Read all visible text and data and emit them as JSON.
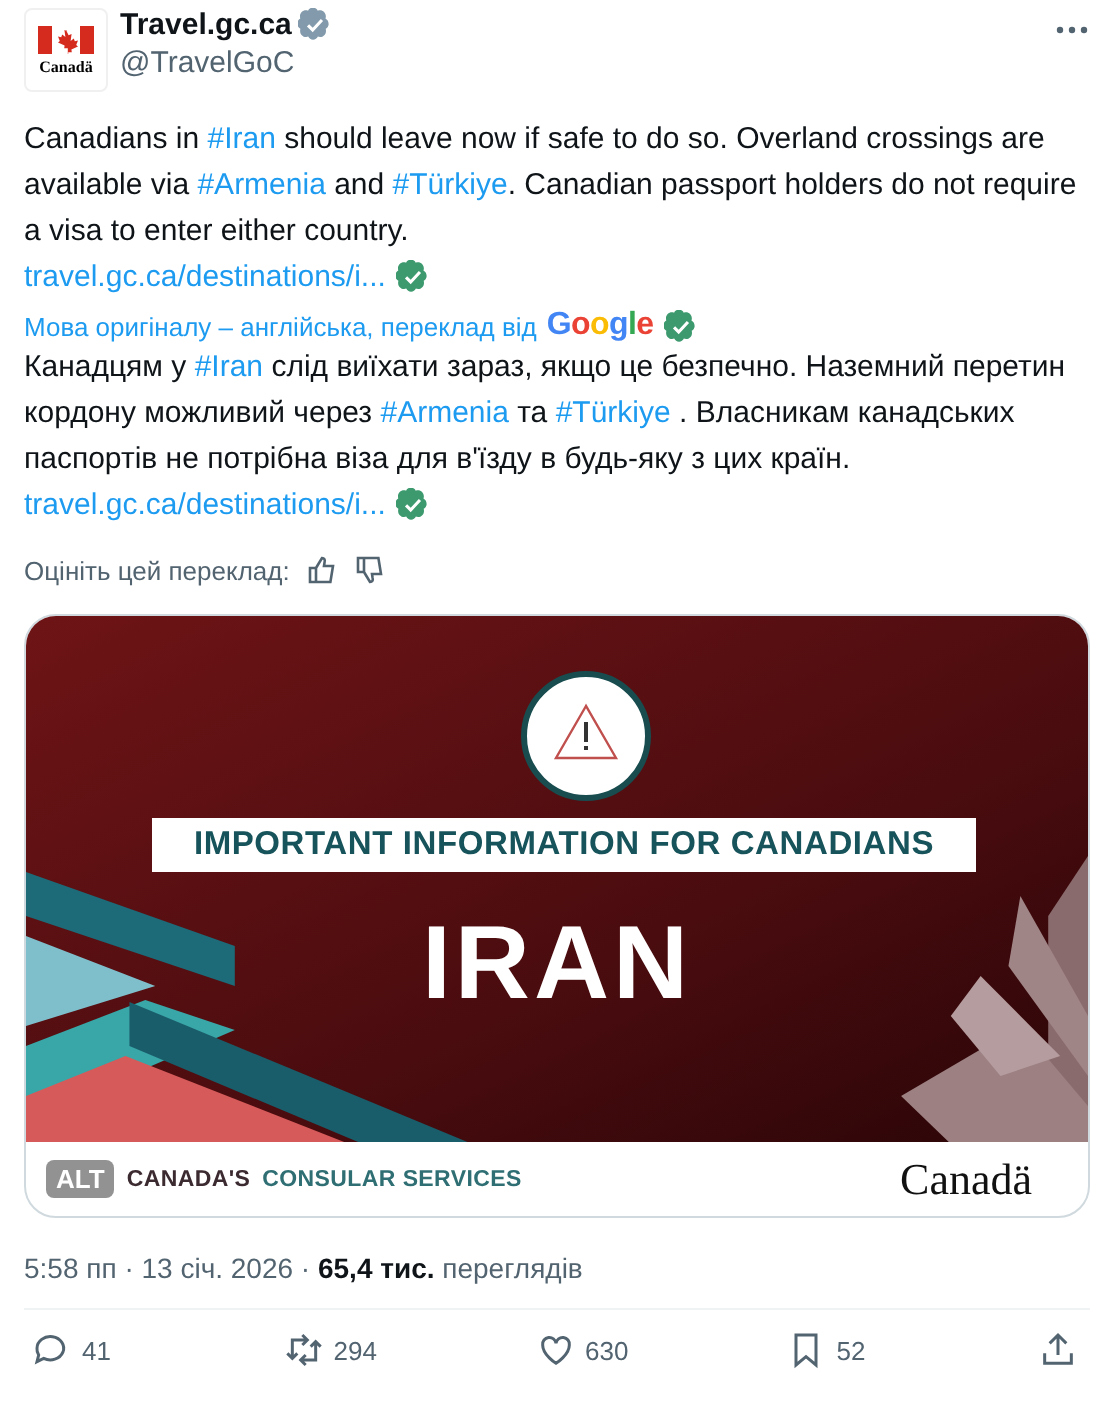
{
  "account": {
    "name": "Travel.gc.ca",
    "verified": true,
    "handle": "@TravelGoC",
    "avatar_wordmark": "Canadä"
  },
  "original_text": [
    {
      "kind": "plain",
      "text": "Canadians in "
    },
    {
      "kind": "hashtag",
      "text": "#Iran"
    },
    {
      "kind": "plain",
      "text": " should leave now if safe to do so. Overland crossings are available via "
    },
    {
      "kind": "hashtag",
      "text": "#Armenia"
    },
    {
      "kind": "plain",
      "text": " and "
    },
    {
      "kind": "hashtag",
      "text": "#Türkiye"
    },
    {
      "kind": "plain",
      "text": ". Canadian passport holders do not require a visa to enter either country."
    }
  ],
  "original_link": {
    "text": "travel.gc.ca/destinations/i...",
    "verified": true
  },
  "translation_note": {
    "text": "Мова оригіналу – англійська, переклад від",
    "provider": "Google",
    "verified": true
  },
  "translated_text": [
    {
      "kind": "plain",
      "text": "Канадцям у "
    },
    {
      "kind": "hashtag",
      "text": "#Iran"
    },
    {
      "kind": "plain",
      "text": " слід виїхати зараз, якщо це безпечно. Наземний перетин кордону можливий через "
    },
    {
      "kind": "hashtag",
      "text": "#Armenia"
    },
    {
      "kind": "plain",
      "text": " та "
    },
    {
      "kind": "hashtag",
      "text": "#Türkiye"
    },
    {
      "kind": "plain",
      "text": " . Власникам канадських паспортів не потрібна віза для в'їзду в будь-яку з цих країн."
    }
  ],
  "translated_link": {
    "text": "travel.gc.ca/destinations/i...",
    "verified": true
  },
  "rate_label": "Оцініть цей переклад:",
  "media": {
    "banner": "IMPORTANT INFORMATION FOR CANADIANS",
    "headline": "IRAN",
    "footer_left": "CANADA'S",
    "footer_right": "CONSULAR SERVICES",
    "wordmark": "Canadä",
    "alt_badge": "ALT"
  },
  "meta": "5:58 пп · 13 січ. 2026 · **65,4 тис.** переглядів",
  "actions": [
    {
      "kind": "reply",
      "count": "41"
    },
    {
      "kind": "repost",
      "count": "294"
    },
    {
      "kind": "like",
      "count": "630"
    },
    {
      "kind": "bookmark",
      "count": "52"
    },
    {
      "kind": "share"
    }
  ]
}
